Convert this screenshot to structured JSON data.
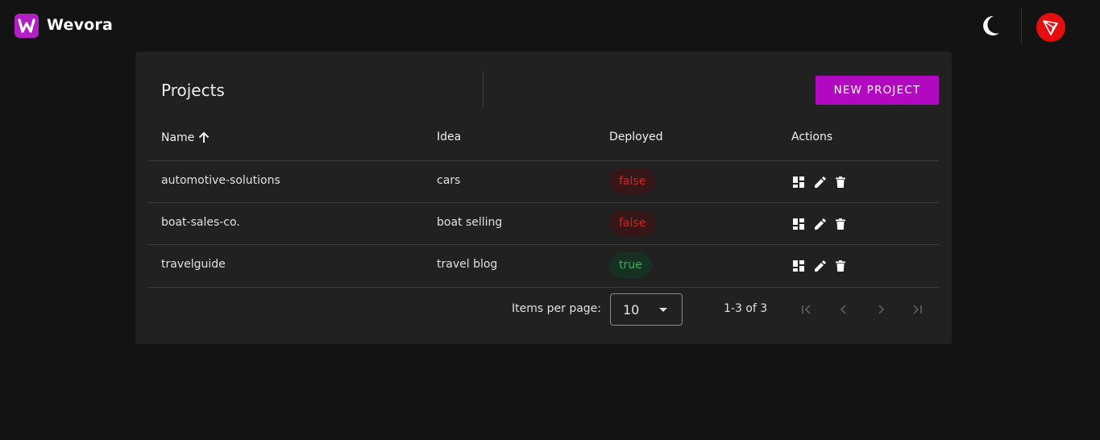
{
  "app": {
    "title": "Wevora",
    "logo_letter": "W"
  },
  "header": {
    "theme_toggle_icon": "moon-icon",
    "avatar_icon": "tron-logo-icon"
  },
  "projects": {
    "title": "Projects",
    "new_button_label": "NEW PROJECT",
    "columns": {
      "name": "Name",
      "idea": "Idea",
      "deployed": "Deployed",
      "actions": "Actions"
    },
    "sort_icon": "arrow-up-icon",
    "rows": [
      {
        "name": "automotive-solutions",
        "idea": "cars",
        "deployed": "false"
      },
      {
        "name": "boat-sales-co.",
        "idea": "boat selling",
        "deployed": "false"
      },
      {
        "name": "travelguide",
        "idea": "travel blog",
        "deployed": "true"
      }
    ],
    "row_action_icons": [
      "dashboard-icon",
      "edit-icon",
      "delete-icon"
    ]
  },
  "paginator": {
    "items_per_page_label": "Items per page:",
    "items_per_page_value": "10",
    "range_label": "1-3 of 3"
  },
  "colors": {
    "background": "#131313",
    "card": "#212121",
    "accent": "#b108c0",
    "false_text": "#d32222",
    "true_text": "#2fb35b",
    "avatar": "#e50d0d"
  }
}
